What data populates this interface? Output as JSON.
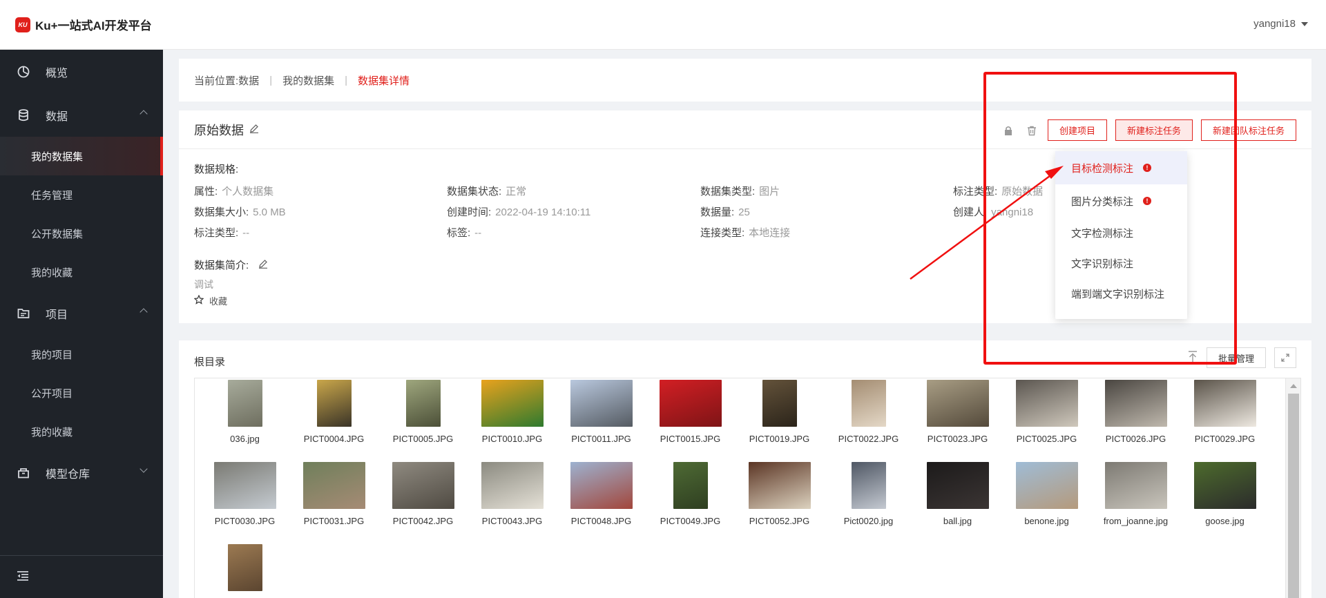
{
  "app": {
    "title": "Ku+一站式AI开发平台",
    "logo_mark": "KU"
  },
  "user": {
    "name": "yangni18"
  },
  "sidebar": {
    "groups": [
      {
        "label": "概览",
        "icon": "dashboard-icon"
      },
      {
        "label": "数据",
        "icon": "database-icon",
        "expanded": true,
        "items": [
          {
            "label": "我的数据集",
            "active": true
          },
          {
            "label": "任务管理"
          },
          {
            "label": "公开数据集"
          },
          {
            "label": "我的收藏"
          }
        ]
      },
      {
        "label": "项目",
        "icon": "folder-icon",
        "expanded": true,
        "items": [
          {
            "label": "我的项目"
          },
          {
            "label": "公开项目"
          },
          {
            "label": "我的收藏"
          }
        ]
      },
      {
        "label": "模型仓库",
        "icon": "model-icon",
        "expanded": false
      }
    ]
  },
  "breadcrumb": {
    "prefix": "当前位置:",
    "items": [
      "数据",
      "我的数据集",
      "数据集详情"
    ]
  },
  "dataset": {
    "title": "原始数据",
    "buttons": {
      "create_project": "创建项目",
      "new_label_task": "新建标注任务",
      "new_team_task": "新建团队标注任务"
    },
    "spec_title": "数据规格:",
    "info": [
      {
        "label": "属性:",
        "value": "个人数据集"
      },
      {
        "label": "数据集状态:",
        "value": "正常"
      },
      {
        "label": "数据集类型:",
        "value": "图片"
      },
      {
        "label": "标注类型:",
        "value": "原始数据"
      },
      {
        "label": "数据集大小:",
        "value": "5.0 MB"
      },
      {
        "label": "创建时间:",
        "value": "2022-04-19 14:10:11"
      },
      {
        "label": "数据量:",
        "value": "25"
      },
      {
        "label": "创建人:",
        "value": "yangni18"
      },
      {
        "label": "标注类型:",
        "value": "--"
      },
      {
        "label": "标签:",
        "value": "--"
      },
      {
        "label": "连接类型:",
        "value": "本地连接"
      }
    ],
    "intro_title": "数据集简介:",
    "intro_text": "调试",
    "favorite_label": "收藏"
  },
  "dropdown": {
    "items": [
      {
        "label": "目标检测标注",
        "selected": true,
        "badge": "!"
      },
      {
        "label": "图片分类标注",
        "badge": "!"
      },
      {
        "label": "文字检测标注"
      },
      {
        "label": "文字识别标注"
      },
      {
        "label": "端到端文字识别标注"
      }
    ]
  },
  "files": {
    "title": "根目录",
    "batch_button": "批量管理",
    "items": [
      {
        "name": "036.jpg",
        "colors": [
          "#a7ab9b",
          "#6e6e5f"
        ],
        "w": 50
      },
      {
        "name": "PICT0004.JPG",
        "colors": [
          "#c9a64a",
          "#3a3428"
        ],
        "w": 50
      },
      {
        "name": "PICT0005.JPG",
        "colors": [
          "#9ea67d",
          "#4c5038"
        ],
        "w": 50
      },
      {
        "name": "PICT0010.JPG",
        "colors": [
          "#e9a21d",
          "#2e7a2f"
        ],
        "w": 90
      },
      {
        "name": "PICT0011.JPG",
        "colors": [
          "#b9c8de",
          "#555b62"
        ],
        "w": 90
      },
      {
        "name": "PICT0015.JPG",
        "colors": [
          "#d21f24",
          "#7e1416"
        ],
        "w": 90
      },
      {
        "name": "PICT0019.JPG",
        "colors": [
          "#63523a",
          "#2b241a"
        ],
        "w": 50
      },
      {
        "name": "PICT0022.JPG",
        "colors": [
          "#a48d72",
          "#e4d8c7"
        ],
        "w": 50
      },
      {
        "name": "PICT0023.JPG",
        "colors": [
          "#a89d84",
          "#544a3b"
        ],
        "w": 90
      },
      {
        "name": "PICT0025.JPG",
        "colors": [
          "#5b5650",
          "#cfc8bc"
        ],
        "w": 90
      },
      {
        "name": "PICT0026.JPG",
        "colors": [
          "#4a4641",
          "#bfb8ad"
        ],
        "w": 90
      },
      {
        "name": "PICT0029.JPG",
        "colors": [
          "#5a5349",
          "#eee9e1"
        ],
        "w": 90
      },
      {
        "name": "PICT0030.JPG",
        "colors": [
          "#7a7a73",
          "#c5cbd1"
        ],
        "w": 90
      },
      {
        "name": "PICT0031.JPG",
        "colors": [
          "#6f7f5b",
          "#a68b75"
        ],
        "w": 90
      },
      {
        "name": "PICT0042.JPG",
        "colors": [
          "#8f8a80",
          "#4f4a42"
        ],
        "w": 90
      },
      {
        "name": "PICT0043.JPG",
        "colors": [
          "#8b8a80",
          "#e5e1d7"
        ],
        "w": 90
      },
      {
        "name": "PICT0048.JPG",
        "colors": [
          "#9db2d0",
          "#a2463b"
        ],
        "w": 90
      },
      {
        "name": "PICT0049.JPG",
        "colors": [
          "#4e6a34",
          "#2f3f21"
        ],
        "w": 50
      },
      {
        "name": "PICT0052.JPG",
        "colors": [
          "#5b3524",
          "#dcd2bf"
        ],
        "w": 90
      },
      {
        "name": "Pict0020.jpg",
        "colors": [
          "#4f5764",
          "#c4c9d1"
        ],
        "w": 50
      },
      {
        "name": "ball.jpg",
        "colors": [
          "#1c1a1a",
          "#3b3534"
        ],
        "w": 90
      },
      {
        "name": "benone.jpg",
        "colors": [
          "#9fbcd6",
          "#b59a7c"
        ],
        "w": 90
      },
      {
        "name": "from_joanne.jpg",
        "colors": [
          "#7d7a73",
          "#c9c5bc"
        ],
        "w": 90
      },
      {
        "name": "goose.jpg",
        "colors": [
          "#4d6b2d",
          "#2b2b2b"
        ],
        "w": 90
      },
      {
        "name": "",
        "colors": [
          "#9c7a52",
          "#5b4530"
        ],
        "w": 50
      }
    ]
  }
}
